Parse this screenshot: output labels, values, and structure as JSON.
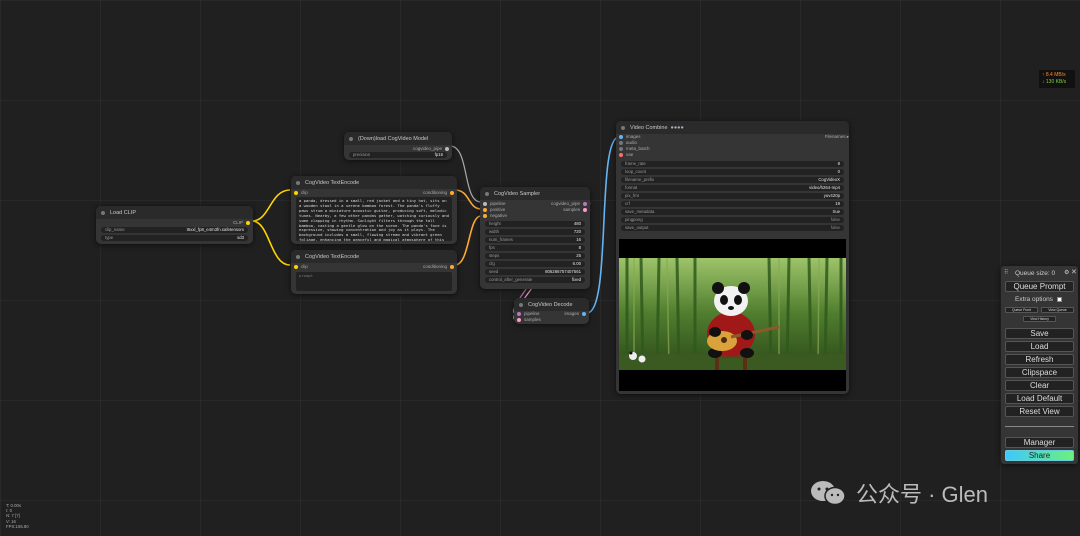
{
  "nodes": {
    "load_clip": {
      "title": "Load CLIP",
      "output": "CLIP",
      "clip_name_label": "clip_name",
      "clip_name_value": "t5xxl_fp8_e4m3fn.safetensors",
      "type_label": "type",
      "type_value": "sd3"
    },
    "download_model": {
      "title": "(Down)load CogVideo Model",
      "output": "cogvideo_pipe",
      "precision_label": "precision",
      "precision_value": "fp16"
    },
    "encode_pos": {
      "title": "CogVideo TextEncode",
      "input": "clip",
      "output": "conditioning",
      "prompt": "a panda, dressed in a small, red jacket and a tiny hat, sits on a wooden stool in a serene bamboo forest. The panda's fluffy paws strum a miniature acoustic guitar, producing soft, melodic tunes. Nearby, a few other pandas gather, watching curiously and some clapping in rhythm. Sunlight filters through the tall bamboo, casting a gentle glow on the scene. The panda's face is expressive, showing concentration and joy as it plays. The background includes a small, flowing stream and vibrant green foliage, enhancing the peaceful and magical atmosphere of this unique musical performance."
    },
    "encode_neg": {
      "title": "CogVideo TextEncode",
      "input": "clip",
      "output": "conditioning",
      "placeholder": "prompt"
    },
    "sampler": {
      "title": "CogVideo Sampler",
      "inputs": [
        "pipeline",
        "positive",
        "negative"
      ],
      "outputs": [
        "cogvideo_pipe",
        "samples"
      ],
      "widgets": [
        {
          "label": "height",
          "value": "480"
        },
        {
          "label": "width",
          "value": "720"
        },
        {
          "label": "num_frames",
          "value": "16"
        },
        {
          "label": "fps",
          "value": "8"
        },
        {
          "label": "steps",
          "value": "25"
        },
        {
          "label": "cfg",
          "value": "6.00"
        },
        {
          "label": "seed",
          "value": "806286757407561"
        },
        {
          "label": "control_after_generate",
          "value": "fixed"
        }
      ]
    },
    "decode": {
      "title": "CogVideo Decode",
      "inputs": [
        "pipeline",
        "samples"
      ],
      "output": "images"
    },
    "video_combine": {
      "title": "Video Combine",
      "inputs": [
        "images",
        "audio",
        "meta_batch",
        "vae"
      ],
      "output": "Filenames",
      "widgets": [
        {
          "label": "frame_rate",
          "value": "8"
        },
        {
          "label": "loop_count",
          "value": "0"
        },
        {
          "label": "filename_prefix",
          "value": "CogVideoX"
        },
        {
          "label": "format",
          "value": "video/h264-mp4"
        },
        {
          "label": "pix_fmt",
          "value": "yuv420p"
        },
        {
          "label": "crf",
          "value": "19"
        },
        {
          "label": "save_metadata",
          "value": "true"
        },
        {
          "label": "pingpong",
          "value": "false"
        },
        {
          "label": "save_output",
          "value": "false"
        }
      ]
    }
  },
  "stats": {
    "up": "↑ 8.4 MB/s",
    "down": "↓ 130 KB/s"
  },
  "menu": {
    "queue_size": "Queue size: 0",
    "queue_prompt": "Queue Prompt",
    "extra_options": "Extra options",
    "queue_front": "Queue Front",
    "view_queue": "View Queue",
    "view_history": "View History",
    "save": "Save",
    "load": "Load",
    "refresh": "Refresh",
    "clipspace": "Clipspace",
    "clear": "Clear",
    "load_default": "Load Default",
    "reset_view": "Reset View",
    "manager": "Manager",
    "share": "Share"
  },
  "watermark": "公众号 · Glen",
  "fps_info": [
    "T: 0.00s",
    "I: 0",
    "N: 7 [7]",
    "V: 16",
    "FPS:165.80"
  ],
  "colors": {
    "clip_wire": "#ffd500",
    "images_wire": "#64b5f6",
    "cond_wire": "#ffa931",
    "share_start": "#3ec8ff",
    "share_end": "#6cf07a"
  }
}
